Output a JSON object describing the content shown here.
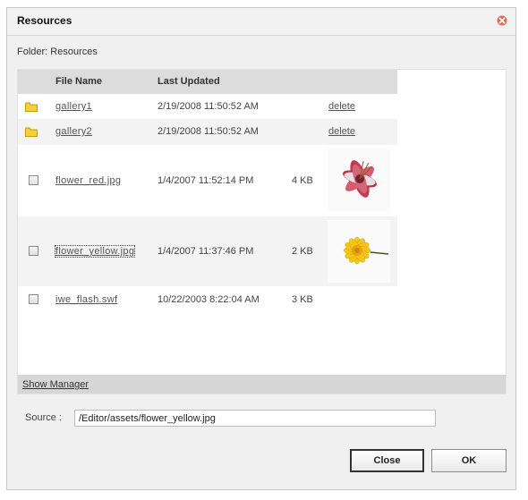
{
  "dialog": {
    "title": "Resources",
    "folder_label": "Folder: Resources"
  },
  "table": {
    "headers": {
      "file_name": "File Name",
      "last_updated": "Last Updated"
    },
    "rows": [
      {
        "type": "folder",
        "name": "gallery1",
        "updated": "2/19/2008 11:50:52 AM",
        "size": "",
        "action": "delete"
      },
      {
        "type": "folder",
        "name": "gallery2",
        "updated": "2/19/2008 11:50:52 AM",
        "size": "",
        "action": "delete"
      },
      {
        "type": "file",
        "name": "flower_red.jpg",
        "updated": "1/4/2007 11:52:14 PM",
        "size": "4 KB",
        "thumbnail": "red-lily-thumbnail"
      },
      {
        "type": "file",
        "name": "flower_yellow.jpg",
        "updated": "1/4/2007 11:37:46 PM",
        "size": "2 KB",
        "thumbnail": "yellow-daisy-thumbnail"
      },
      {
        "type": "file",
        "name": "iwe_flash.swf",
        "updated": "10/22/2003 8:22:04 AM",
        "size": "3 KB"
      }
    ]
  },
  "footer": {
    "show_manager": "Show Manager"
  },
  "source": {
    "label": "Source :",
    "value": "/Editor/assets/flower_yellow.jpg"
  },
  "buttons": {
    "close": "Close",
    "ok": "OK"
  },
  "colors": {
    "close_icon": "#d94a3a",
    "folder_icon": "#f2c21a",
    "header_bg": "#dcdcdc"
  }
}
